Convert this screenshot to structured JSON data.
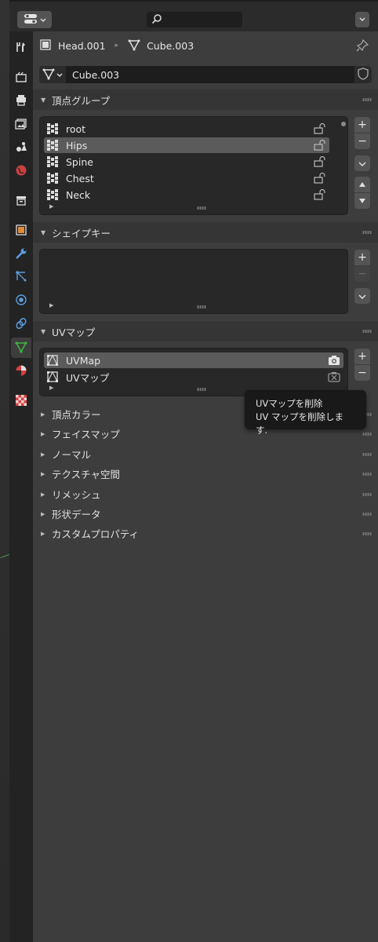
{
  "header": {
    "editor_type_icon": "properties-editor-icon",
    "search_icon": "search-icon",
    "options_icon": "chevron-down-icon"
  },
  "breadcrumb": {
    "object_name": "Head.001",
    "mesh_name": "Cube.003"
  },
  "mesh_datablock": {
    "name": "Cube.003"
  },
  "sections": {
    "vertex_groups": {
      "title": "頂点グループ",
      "items": [
        {
          "label": "root"
        },
        {
          "label": "Hips"
        },
        {
          "label": "Spine"
        },
        {
          "label": "Chest"
        },
        {
          "label": "Neck"
        }
      ],
      "selected_index": 1
    },
    "shape_keys": {
      "title": "シェイプキー"
    },
    "uv_maps": {
      "title": "UVマップ",
      "items": [
        {
          "label": "UVMap"
        },
        {
          "label": "UVマップ"
        }
      ],
      "selected_index": 0
    },
    "closed": [
      {
        "label": "頂点カラー"
      },
      {
        "label": "フェイスマップ"
      },
      {
        "label": "ノーマル"
      },
      {
        "label": "テクスチャ空間"
      },
      {
        "label": "リメッシュ"
      },
      {
        "label": "形状データ"
      },
      {
        "label": "カスタムプロパティ"
      }
    ]
  },
  "tooltip": {
    "title": "UVマップを削除",
    "description": "UV マップを削除します."
  },
  "buttons": {
    "add": "+",
    "remove": "−"
  },
  "colors": {
    "panel_bg": "#3d3d3d",
    "header_bg": "#2b2b2b",
    "list_bg": "#282828",
    "selected_row": "#5b5b5b",
    "mesh_data_icon": "#3fb43f",
    "object_icon": "#e08a3a",
    "material_icon": "#d44040"
  }
}
